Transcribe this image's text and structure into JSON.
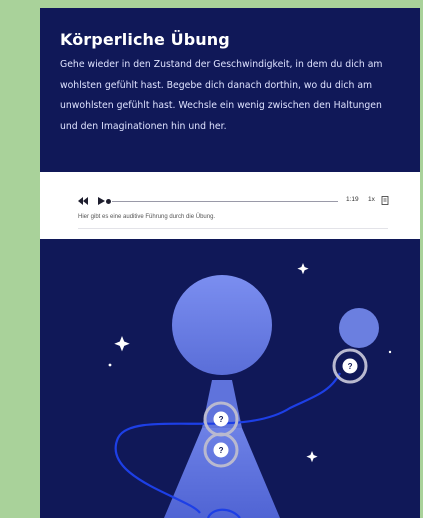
{
  "exercise": {
    "title": "Körperliche Übung",
    "description": "Gehe wieder in den Zustand der Geschwindigkeit, in dem du dich am wohlsten gefühlt hast. Begebe dich danach dorthin, wo du dich am unwohlsten gefühlt hast. Wechsle ein wenig zwischen den Haltungen und den Imaginationen hin und her."
  },
  "audio": {
    "time": "1:19",
    "speed": "1x",
    "caption": "Hier gibt es eine auditive Führung durch die Übung.",
    "rewind_icon": "rewind-icon",
    "play_icon": "play-icon",
    "download_icon": "download-icon"
  },
  "hotspots": [
    {
      "label": "?"
    },
    {
      "label": "?"
    },
    {
      "label": "?"
    }
  ],
  "colors": {
    "page_background": "#a9d29a",
    "card_background": "#101858",
    "figure": "#6b7fe0",
    "accent_line": "#1d3fe6"
  }
}
